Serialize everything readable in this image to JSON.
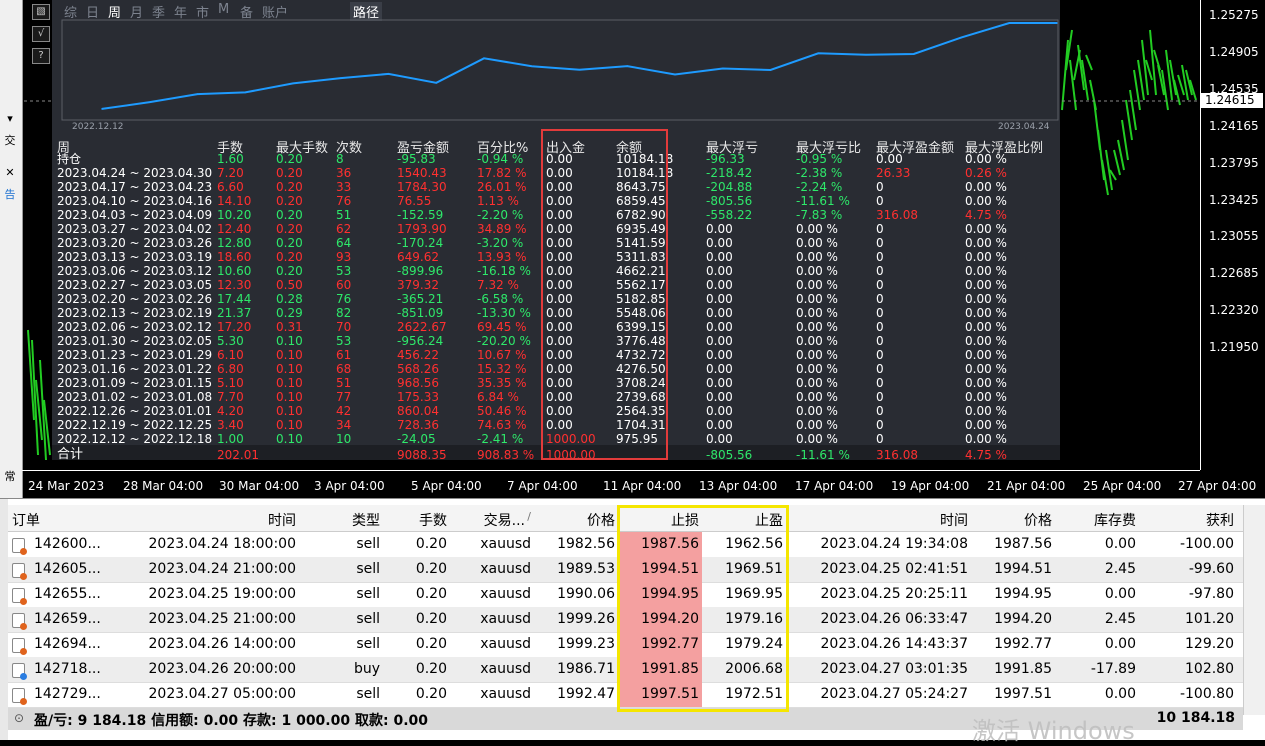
{
  "left_strip": [
    "交",
    "告",
    "常"
  ],
  "report": {
    "tabs": [
      "综",
      "日",
      "周",
      "月",
      "季",
      "年",
      "市",
      "M",
      "备",
      "账户"
    ],
    "active_tab": "周",
    "path_tab": "路径",
    "equity_start_date": "2022.12.12",
    "equity_end_date": "2023.04.24",
    "headers": [
      "周",
      "手数",
      "最大手数",
      "次数",
      "盈亏金额",
      "百分比%",
      "出入金",
      "余额",
      "最大浮亏",
      "最大浮亏比",
      "最大浮盈金额",
      "最大浮盈比例"
    ],
    "rows": [
      [
        "持仓",
        "1.60",
        "0.20",
        "8",
        "-95.83",
        "-0.94 %",
        "0.00",
        "10184.18",
        "-96.33",
        "-0.95 %",
        "0.00",
        "0.00 %"
      ],
      [
        "2023.04.24 ~ 2023.04.30",
        "7.20",
        "0.20",
        "36",
        "1540.43",
        "17.82 %",
        "0.00",
        "10184.18",
        "-218.42",
        "-2.38 %",
        "26.33",
        "0.26 %"
      ],
      [
        "2023.04.17 ~ 2023.04.23",
        "6.60",
        "0.20",
        "33",
        "1784.30",
        "26.01 %",
        "0.00",
        "8643.75",
        "-204.88",
        "-2.24 %",
        "0",
        "0.00 %"
      ],
      [
        "2023.04.10 ~ 2023.04.16",
        "14.10",
        "0.20",
        "76",
        "76.55",
        "1.13 %",
        "0.00",
        "6859.45",
        "-805.56",
        "-11.61 %",
        "0",
        "0.00 %"
      ],
      [
        "2023.04.03 ~ 2023.04.09",
        "10.20",
        "0.20",
        "51",
        "-152.59",
        "-2.20 %",
        "0.00",
        "6782.90",
        "-558.22",
        "-7.83 %",
        "316.08",
        "4.75 %"
      ],
      [
        "2023.03.27 ~ 2023.04.02",
        "12.40",
        "0.20",
        "62",
        "1793.90",
        "34.89 %",
        "0.00",
        "6935.49",
        "0.00",
        "0.00 %",
        "0",
        "0.00 %"
      ],
      [
        "2023.03.20 ~ 2023.03.26",
        "12.80",
        "0.20",
        "64",
        "-170.24",
        "-3.20 %",
        "0.00",
        "5141.59",
        "0.00",
        "0.00 %",
        "0",
        "0.00 %"
      ],
      [
        "2023.03.13 ~ 2023.03.19",
        "18.60",
        "0.20",
        "93",
        "649.62",
        "13.93 %",
        "0.00",
        "5311.83",
        "0.00",
        "0.00 %",
        "0",
        "0.00 %"
      ],
      [
        "2023.03.06 ~ 2023.03.12",
        "10.60",
        "0.20",
        "53",
        "-899.96",
        "-16.18 %",
        "0.00",
        "4662.21",
        "0.00",
        "0.00 %",
        "0",
        "0.00 %"
      ],
      [
        "2023.02.27 ~ 2023.03.05",
        "12.30",
        "0.50",
        "60",
        "379.32",
        "7.32 %",
        "0.00",
        "5562.17",
        "0.00",
        "0.00 %",
        "0",
        "0.00 %"
      ],
      [
        "2023.02.20 ~ 2023.02.26",
        "17.44",
        "0.28",
        "76",
        "-365.21",
        "-6.58 %",
        "0.00",
        "5182.85",
        "0.00",
        "0.00 %",
        "0",
        "0.00 %"
      ],
      [
        "2023.02.13 ~ 2023.02.19",
        "21.37",
        "0.29",
        "82",
        "-851.09",
        "-13.30 %",
        "0.00",
        "5548.06",
        "0.00",
        "0.00 %",
        "0",
        "0.00 %"
      ],
      [
        "2023.02.06 ~ 2023.02.12",
        "17.20",
        "0.31",
        "70",
        "2622.67",
        "69.45 %",
        "0.00",
        "6399.15",
        "0.00",
        "0.00 %",
        "0",
        "0.00 %"
      ],
      [
        "2023.01.30 ~ 2023.02.05",
        "5.30",
        "0.10",
        "53",
        "-956.24",
        "-20.20 %",
        "0.00",
        "3776.48",
        "0.00",
        "0.00 %",
        "0",
        "0.00 %"
      ],
      [
        "2023.01.23 ~ 2023.01.29",
        "6.10",
        "0.10",
        "61",
        "456.22",
        "10.67 %",
        "0.00",
        "4732.72",
        "0.00",
        "0.00 %",
        "0",
        "0.00 %"
      ],
      [
        "2023.01.16 ~ 2023.01.22",
        "6.80",
        "0.10",
        "68",
        "568.26",
        "15.32 %",
        "0.00",
        "4276.50",
        "0.00",
        "0.00 %",
        "0",
        "0.00 %"
      ],
      [
        "2023.01.09 ~ 2023.01.15",
        "5.10",
        "0.10",
        "51",
        "968.56",
        "35.35 %",
        "0.00",
        "3708.24",
        "0.00",
        "0.00 %",
        "0",
        "0.00 %"
      ],
      [
        "2023.01.02 ~ 2023.01.08",
        "7.70",
        "0.10",
        "77",
        "175.33",
        "6.84 %",
        "0.00",
        "2739.68",
        "0.00",
        "0.00 %",
        "0",
        "0.00 %"
      ],
      [
        "2022.12.26 ~ 2023.01.01",
        "4.20",
        "0.10",
        "42",
        "860.04",
        "50.46 %",
        "0.00",
        "2564.35",
        "0.00",
        "0.00 %",
        "0",
        "0.00 %"
      ],
      [
        "2022.12.19 ~ 2022.12.25",
        "3.40",
        "0.10",
        "34",
        "728.36",
        "74.63 %",
        "0.00",
        "1704.31",
        "0.00",
        "0.00 %",
        "0",
        "0.00 %"
      ],
      [
        "2022.12.12 ~ 2022.12.18",
        "1.00",
        "0.10",
        "10",
        "-24.05",
        "-2.41 %",
        "1000.00",
        "975.95",
        "0.00",
        "0.00 %",
        "0",
        "0.00 %"
      ],
      [
        "合计",
        "202.01",
        "",
        "",
        "9088.35",
        "908.83 %",
        "1000.00",
        "",
        "-805.56",
        "-11.61 %",
        "316.08",
        "4.75 %"
      ]
    ],
    "equity_balances": [
      975.95,
      1704.31,
      2564.35,
      2739.68,
      3708.24,
      4276.5,
      4732.72,
      3776.48,
      6399.15,
      5548.06,
      5182.85,
      5562.17,
      4662.21,
      5311.83,
      5141.59,
      6935.49,
      6782.9,
      6859.45,
      8643.75,
      10184.18,
      10184.18
    ]
  },
  "price_axis": [
    "1.25275",
    "1.24905",
    "1.24535",
    "1.24165",
    "1.23795",
    "1.23425",
    "1.23055",
    "1.22685",
    "1.22320",
    "1.21950"
  ],
  "current_price": "1.24615",
  "time_axis": [
    "24 Mar 2023",
    "28 Mar 04:00",
    "30 Mar 04:00",
    "3 Apr 04:00",
    "5 Apr 04:00",
    "7 Apr 04:00",
    "11 Apr 04:00",
    "13 Apr 04:00",
    "17 Apr 04:00",
    "19 Apr 04:00",
    "21 Apr 04:00",
    "25 Apr 04:00",
    "27 Apr 04:00"
  ],
  "terminal": {
    "headers": [
      "订单",
      "时间",
      "类型",
      "手数",
      "交易...",
      "价格",
      "止损",
      "止盈",
      "时间",
      "价格",
      "库存费",
      "获利"
    ],
    "sort_indicator": "/",
    "orders": [
      {
        "id": "142600...",
        "time": "2023.04.24 18:00:00",
        "type": "sell",
        "lots": "0.20",
        "symbol": "xauusd",
        "price": "1982.56",
        "sl": "1987.56",
        "tp": "1962.56",
        "close_time": "2023.04.24 19:34:08",
        "close_price": "1987.56",
        "swap": "0.00",
        "profit": "-100.00"
      },
      {
        "id": "142605...",
        "time": "2023.04.24 21:00:00",
        "type": "sell",
        "lots": "0.20",
        "symbol": "xauusd",
        "price": "1989.53",
        "sl": "1994.51",
        "tp": "1969.51",
        "close_time": "2023.04.25 02:41:51",
        "close_price": "1994.51",
        "swap": "2.45",
        "profit": "-99.60"
      },
      {
        "id": "142655...",
        "time": "2023.04.25 19:00:00",
        "type": "sell",
        "lots": "0.20",
        "symbol": "xauusd",
        "price": "1990.06",
        "sl": "1994.95",
        "tp": "1969.95",
        "close_time": "2023.04.25 20:25:11",
        "close_price": "1994.95",
        "swap": "0.00",
        "profit": "-97.80"
      },
      {
        "id": "142659...",
        "time": "2023.04.25 21:00:00",
        "type": "sell",
        "lots": "0.20",
        "symbol": "xauusd",
        "price": "1999.26",
        "sl": "1994.20",
        "tp": "1979.16",
        "close_time": "2023.04.26 06:33:47",
        "close_price": "1994.20",
        "swap": "2.45",
        "profit": "101.20"
      },
      {
        "id": "142694...",
        "time": "2023.04.26 14:00:00",
        "type": "sell",
        "lots": "0.20",
        "symbol": "xauusd",
        "price": "1999.23",
        "sl": "1992.77",
        "tp": "1979.24",
        "close_time": "2023.04.26 14:43:37",
        "close_price": "1992.77",
        "swap": "0.00",
        "profit": "129.20"
      },
      {
        "id": "142718...",
        "time": "2023.04.26 20:00:00",
        "type": "buy",
        "lots": "0.20",
        "symbol": "xauusd",
        "price": "1986.71",
        "sl": "1991.85",
        "tp": "2006.68",
        "close_time": "2023.04.27 03:01:35",
        "close_price": "1991.85",
        "swap": "-17.89",
        "profit": "102.80"
      },
      {
        "id": "142729...",
        "time": "2023.04.27 05:00:00",
        "type": "sell",
        "lots": "0.20",
        "symbol": "xauusd",
        "price": "1992.47",
        "sl": "1997.51",
        "tp": "1972.51",
        "close_time": "2023.04.27 05:24:27",
        "close_price": "1997.51",
        "swap": "0.00",
        "profit": "-100.80"
      }
    ],
    "summary": "盈/亏: 9 184.18  信用额: 0.00  存款: 1 000.00  取款: 0.00",
    "summary_total": "10 184.18",
    "watermark": "激活 Windows"
  },
  "colors": {
    "profit_up": "#2ee86a",
    "profit_down": "#ff3030",
    "equity_line": "#1e9bff",
    "highlight_box": "#e23b3b",
    "yellow_box": "#f5e600",
    "sl_fill": "#f4a0a0",
    "candle": "#22cc22"
  }
}
